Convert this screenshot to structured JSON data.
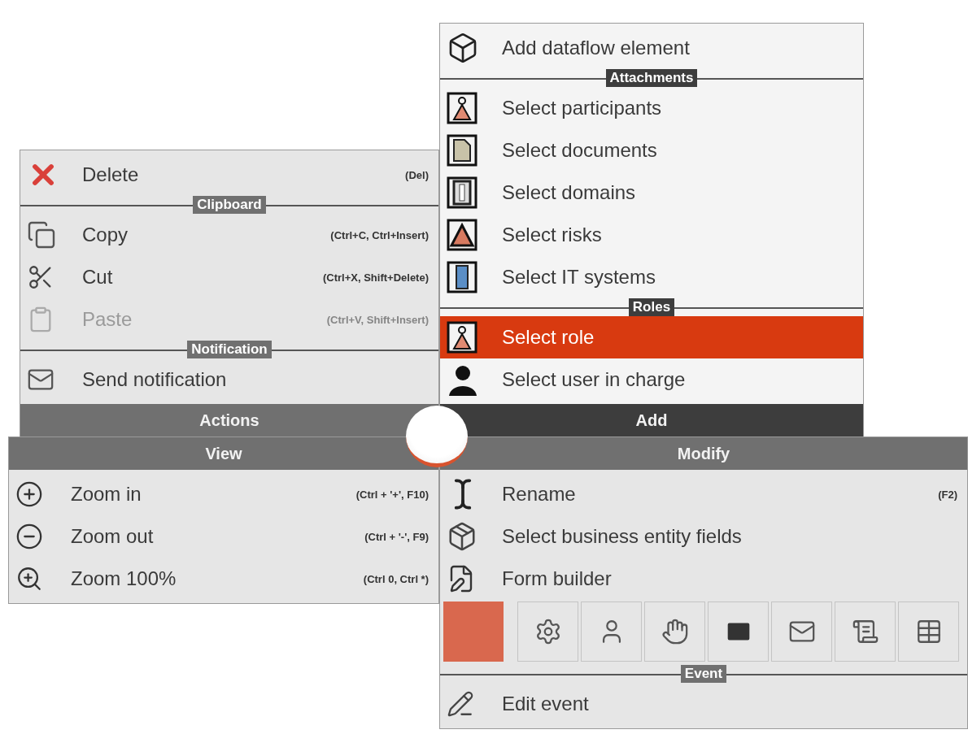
{
  "panels": [
    {
      "title": "Actions",
      "active": false,
      "groups": [
        {
          "items": [
            {
              "kind": "delete",
              "label": "Delete",
              "shortcut": "(Del)",
              "disabled": false,
              "selected": false
            }
          ]
        },
        {
          "heading": "Clipboard",
          "items": [
            {
              "kind": "copy",
              "label": "Copy",
              "shortcut": "(Ctrl+C, Ctrl+Insert)",
              "disabled": false,
              "selected": false
            },
            {
              "kind": "cut",
              "label": "Cut",
              "shortcut": "(Ctrl+X, Shift+Delete)",
              "disabled": false,
              "selected": false
            },
            {
              "kind": "paste",
              "label": "Paste",
              "shortcut": "(Ctrl+V, Shift+Insert)",
              "disabled": true,
              "selected": false
            }
          ]
        },
        {
          "heading": "Notification",
          "items": [
            {
              "kind": "mail",
              "label": "Send notification",
              "disabled": false,
              "selected": false
            }
          ]
        }
      ]
    },
    {
      "title": "Add",
      "active": true,
      "groups": [
        {
          "items": [
            {
              "kind": "box",
              "label": "Add dataflow element",
              "disabled": false,
              "selected": false
            }
          ]
        },
        {
          "heading": "Attachments",
          "items": [
            {
              "kind": "participant",
              "label": "Select participants",
              "disabled": false,
              "selected": false
            },
            {
              "kind": "document",
              "label": "Select documents",
              "disabled": false,
              "selected": false
            },
            {
              "kind": "domain",
              "label": "Select domains",
              "disabled": false,
              "selected": false
            },
            {
              "kind": "risk",
              "label": "Select risks",
              "disabled": false,
              "selected": false
            },
            {
              "kind": "system",
              "label": "Select IT systems",
              "disabled": false,
              "selected": false
            }
          ]
        },
        {
          "heading": "Roles",
          "items": [
            {
              "kind": "participant",
              "label": "Select role",
              "disabled": false,
              "selected": true
            },
            {
              "kind": "user",
              "label": "Select user in charge",
              "disabled": false,
              "selected": false
            }
          ]
        }
      ]
    },
    {
      "title": "View",
      "active": false,
      "groups": [
        {
          "items": [
            {
              "kind": "zoom-in",
              "label": "Zoom in",
              "shortcut": "(Ctrl + '+', F10)",
              "disabled": false,
              "selected": false
            },
            {
              "kind": "zoom-out",
              "label": "Zoom out",
              "shortcut": "(Ctrl + '-', F9)",
              "disabled": false,
              "selected": false
            },
            {
              "kind": "zoom-fit",
              "label": "Zoom 100%",
              "shortcut": "(Ctrl 0, Ctrl *)",
              "disabled": false,
              "selected": false
            }
          ]
        }
      ]
    },
    {
      "title": "Modify",
      "active": false,
      "groups": [
        {
          "items": [
            {
              "kind": "rename",
              "label": "Rename",
              "shortcut": "(F2)",
              "disabled": false,
              "selected": false
            },
            {
              "kind": "entity",
              "label": "Select business entity fields",
              "disabled": false,
              "selected": false
            },
            {
              "kind": "form",
              "label": "Form builder",
              "disabled": false,
              "selected": false
            }
          ],
          "tiles": [
            {
              "kind": "swatch",
              "color": "#d9684e"
            },
            {
              "kind": "gear"
            },
            {
              "kind": "person"
            },
            {
              "kind": "hand"
            },
            {
              "kind": "mail-filled"
            },
            {
              "kind": "mail"
            },
            {
              "kind": "script"
            },
            {
              "kind": "table"
            }
          ]
        },
        {
          "heading": "Event",
          "items": [
            {
              "kind": "edit-event",
              "label": "Edit event",
              "disabled": false,
              "selected": false
            }
          ]
        }
      ]
    }
  ]
}
